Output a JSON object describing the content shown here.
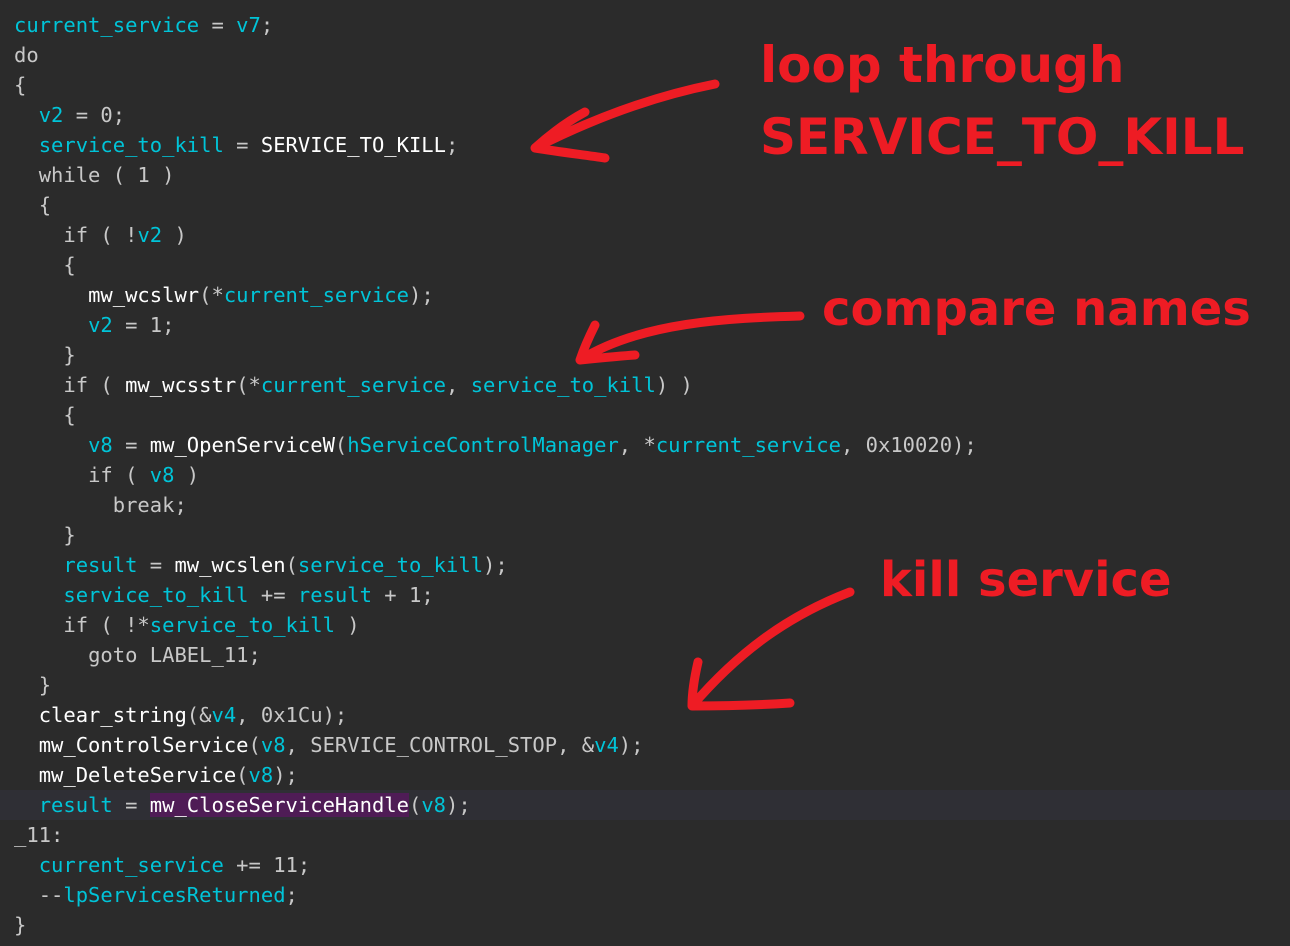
{
  "code_lines": [
    {
      "highlight": false,
      "tokens": [
        {
          "t": "current_service",
          "c": "v"
        },
        {
          "t": " = ",
          "c": "g"
        },
        {
          "t": "v7",
          "c": "v"
        },
        {
          "t": ";",
          "c": "g"
        }
      ]
    },
    {
      "highlight": false,
      "tokens": [
        {
          "t": "do",
          "c": "g"
        }
      ]
    },
    {
      "highlight": false,
      "tokens": [
        {
          "t": "{",
          "c": "g"
        }
      ]
    },
    {
      "highlight": false,
      "tokens": [
        {
          "t": "  "
        },
        {
          "t": "v2",
          "c": "v"
        },
        {
          "t": " = 0;",
          "c": "g"
        }
      ]
    },
    {
      "highlight": false,
      "tokens": [
        {
          "t": "  "
        },
        {
          "t": "service_to_kill",
          "c": "v"
        },
        {
          "t": " = ",
          "c": "g"
        },
        {
          "t": "SERVICE_TO_KILL",
          "c": "f"
        },
        {
          "t": ";",
          "c": "g"
        }
      ]
    },
    {
      "highlight": false,
      "tokens": [
        {
          "t": "  "
        },
        {
          "t": "while ( 1 )",
          "c": "g"
        }
      ]
    },
    {
      "highlight": false,
      "tokens": [
        {
          "t": "  "
        },
        {
          "t": "{",
          "c": "g"
        }
      ]
    },
    {
      "highlight": false,
      "tokens": [
        {
          "t": "    "
        },
        {
          "t": "if ( !",
          "c": "g"
        },
        {
          "t": "v2",
          "c": "v"
        },
        {
          "t": " )",
          "c": "g"
        }
      ]
    },
    {
      "highlight": false,
      "tokens": [
        {
          "t": "    "
        },
        {
          "t": "{",
          "c": "g"
        }
      ]
    },
    {
      "highlight": false,
      "tokens": [
        {
          "t": "      "
        },
        {
          "t": "mw_wcslwr",
          "c": "f"
        },
        {
          "t": "(*",
          "c": "g"
        },
        {
          "t": "current_service",
          "c": "v"
        },
        {
          "t": ");",
          "c": "g"
        }
      ]
    },
    {
      "highlight": false,
      "tokens": [
        {
          "t": "      "
        },
        {
          "t": "v2",
          "c": "v"
        },
        {
          "t": " = 1;",
          "c": "g"
        }
      ]
    },
    {
      "highlight": false,
      "tokens": [
        {
          "t": "    "
        },
        {
          "t": "}",
          "c": "g"
        }
      ]
    },
    {
      "highlight": false,
      "tokens": [
        {
          "t": "    "
        },
        {
          "t": "if ( ",
          "c": "g"
        },
        {
          "t": "mw_wcsstr",
          "c": "f"
        },
        {
          "t": "(*",
          "c": "g"
        },
        {
          "t": "current_service",
          "c": "v"
        },
        {
          "t": ", ",
          "c": "g"
        },
        {
          "t": "service_to_kill",
          "c": "v"
        },
        {
          "t": ") )",
          "c": "g"
        }
      ]
    },
    {
      "highlight": false,
      "tokens": [
        {
          "t": "    "
        },
        {
          "t": "{",
          "c": "g"
        }
      ]
    },
    {
      "highlight": false,
      "tokens": [
        {
          "t": "      "
        },
        {
          "t": "v8",
          "c": "v"
        },
        {
          "t": " = ",
          "c": "g"
        },
        {
          "t": "mw_OpenServiceW",
          "c": "f"
        },
        {
          "t": "(",
          "c": "g"
        },
        {
          "t": "hServiceControlManager",
          "c": "v"
        },
        {
          "t": ", *",
          "c": "g"
        },
        {
          "t": "current_service",
          "c": "v"
        },
        {
          "t": ", 0x10020);",
          "c": "g"
        }
      ]
    },
    {
      "highlight": false,
      "tokens": [
        {
          "t": "      "
        },
        {
          "t": "if ( ",
          "c": "g"
        },
        {
          "t": "v8",
          "c": "v"
        },
        {
          "t": " )",
          "c": "g"
        }
      ]
    },
    {
      "highlight": false,
      "tokens": [
        {
          "t": "        "
        },
        {
          "t": "break;",
          "c": "g"
        }
      ]
    },
    {
      "highlight": false,
      "tokens": [
        {
          "t": "    "
        },
        {
          "t": "}",
          "c": "g"
        }
      ]
    },
    {
      "highlight": false,
      "tokens": [
        {
          "t": "    "
        },
        {
          "t": "result",
          "c": "v"
        },
        {
          "t": " = ",
          "c": "g"
        },
        {
          "t": "mw_wcslen",
          "c": "f"
        },
        {
          "t": "(",
          "c": "g"
        },
        {
          "t": "service_to_kill",
          "c": "v"
        },
        {
          "t": ");",
          "c": "g"
        }
      ]
    },
    {
      "highlight": false,
      "tokens": [
        {
          "t": "    "
        },
        {
          "t": "service_to_kill",
          "c": "v"
        },
        {
          "t": " += ",
          "c": "g"
        },
        {
          "t": "result",
          "c": "v"
        },
        {
          "t": " + 1;",
          "c": "g"
        }
      ]
    },
    {
      "highlight": false,
      "tokens": [
        {
          "t": "    "
        },
        {
          "t": "if ( !*",
          "c": "g"
        },
        {
          "t": "service_to_kill",
          "c": "v"
        },
        {
          "t": " )",
          "c": "g"
        }
      ]
    },
    {
      "highlight": false,
      "tokens": [
        {
          "t": "      "
        },
        {
          "t": "goto ",
          "c": "g"
        },
        {
          "t": "LABEL_11",
          "c": "l"
        },
        {
          "t": ";",
          "c": "g"
        }
      ]
    },
    {
      "highlight": false,
      "tokens": [
        {
          "t": "  "
        },
        {
          "t": "}",
          "c": "g"
        }
      ]
    },
    {
      "highlight": false,
      "tokens": [
        {
          "t": "  "
        },
        {
          "t": "clear_string",
          "c": "f"
        },
        {
          "t": "(&",
          "c": "g"
        },
        {
          "t": "v4",
          "c": "v"
        },
        {
          "t": ", 0x1Cu);",
          "c": "g"
        }
      ]
    },
    {
      "highlight": false,
      "tokens": [
        {
          "t": "  "
        },
        {
          "t": "mw_ControlService",
          "c": "f"
        },
        {
          "t": "(",
          "c": "g"
        },
        {
          "t": "v8",
          "c": "v"
        },
        {
          "t": ", ",
          "c": "g"
        },
        {
          "t": "SERVICE_CONTROL_STOP",
          "c": "n"
        },
        {
          "t": ", &",
          "c": "g"
        },
        {
          "t": "v4",
          "c": "v"
        },
        {
          "t": ");",
          "c": "g"
        }
      ]
    },
    {
      "highlight": false,
      "tokens": [
        {
          "t": "  "
        },
        {
          "t": "mw_DeleteService",
          "c": "f"
        },
        {
          "t": "(",
          "c": "g"
        },
        {
          "t": "v8",
          "c": "v"
        },
        {
          "t": ");",
          "c": "g"
        }
      ]
    },
    {
      "highlight": true,
      "tokens": [
        {
          "t": "  "
        },
        {
          "t": "result",
          "c": "v"
        },
        {
          "t": " = ",
          "c": "g"
        },
        {
          "t": "mw_CloseServiceHandle",
          "c": "hf"
        },
        {
          "t": "(",
          "c": "g"
        },
        {
          "t": "v8",
          "c": "v"
        },
        {
          "t": ");",
          "c": "g"
        }
      ]
    },
    {
      "highlight": false,
      "tokens": [
        {
          "t": "_11:",
          "c": "l"
        }
      ]
    },
    {
      "highlight": false,
      "tokens": [
        {
          "t": "  "
        },
        {
          "t": "current_service",
          "c": "v"
        },
        {
          "t": " += 11;",
          "c": "g"
        }
      ]
    },
    {
      "highlight": false,
      "tokens": [
        {
          "t": "  "
        },
        {
          "t": "--",
          "c": "g"
        },
        {
          "t": "lpServicesReturned",
          "c": "v"
        },
        {
          "t": ";",
          "c": "g"
        }
      ]
    },
    {
      "highlight": false,
      "tokens": [
        {
          "t": "}",
          "c": "g"
        }
      ]
    }
  ],
  "annotations": {
    "loop_line1": "loop through",
    "loop_line2": "SERVICE_TO_KILL",
    "compare": "compare names",
    "kill": "kill service"
  },
  "colors": {
    "background": "#2b2b2b",
    "variable": "#00c4d8",
    "function": "#ffffff",
    "plain": "#c8c8c8",
    "annotation": "#ee1c24",
    "highlight_fn_bg": "#4f1c56"
  }
}
